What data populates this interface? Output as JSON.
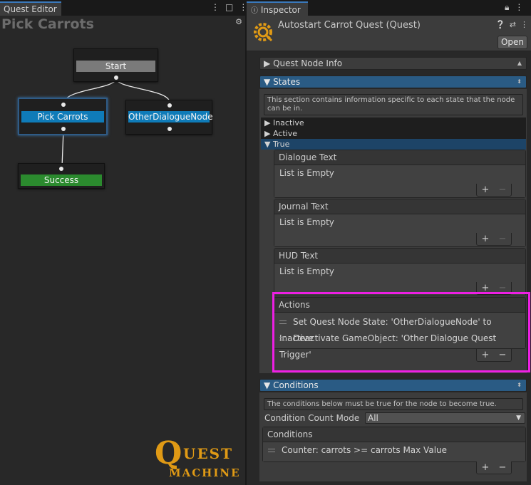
{
  "quest_editor": {
    "tab_label": "Quest Editor",
    "graph_title": "Pick Carrots",
    "nodes": {
      "start": "Start",
      "pick_carrots": "Pick Carrots",
      "other_dialogue": "OtherDialogueNode",
      "success": "Success"
    },
    "logo": {
      "q": "Q",
      "uest": "UEST",
      "machine": "MACHINE"
    },
    "colors": {
      "start": "#7a7a7a",
      "selected_node": "#0f7bb8",
      "success": "#2b8a2e",
      "logo": "#e09a15"
    }
  },
  "inspector": {
    "tab_label": "Inspector",
    "title": "Autostart Carrot Quest (Quest)",
    "open_button": "Open",
    "quest_node_info": "Quest Node Info",
    "states": {
      "label": "States",
      "help": "This section contains information specific to each state that the node can be in.",
      "rows": [
        "Inactive",
        "Active",
        "True"
      ],
      "dialogue_text": {
        "label": "Dialogue Text",
        "empty": "List is Empty"
      },
      "journal_text": {
        "label": "Journal Text",
        "empty": "List is Empty"
      },
      "hud_text": {
        "label": "HUD Text",
        "empty": "List is Empty"
      },
      "actions": {
        "label": "Actions",
        "items": [
          "Set Quest Node State: 'OtherDialogueNode' to Inactive",
          "Deactivate GameObject: 'Other Dialogue Quest Trigger'"
        ]
      }
    },
    "conditions": {
      "label": "Conditions",
      "help": "The conditions below must be true for the node to become true.",
      "count_mode_label": "Condition Count Mode",
      "count_mode_value": "All",
      "list_label": "Conditions",
      "items": [
        "Counter: carrots >= carrots Max Value"
      ]
    },
    "add_symbol": "+",
    "remove_symbol": "−",
    "highlight_color": "#ee1fe4",
    "accent_blue": "#2a5b84"
  }
}
